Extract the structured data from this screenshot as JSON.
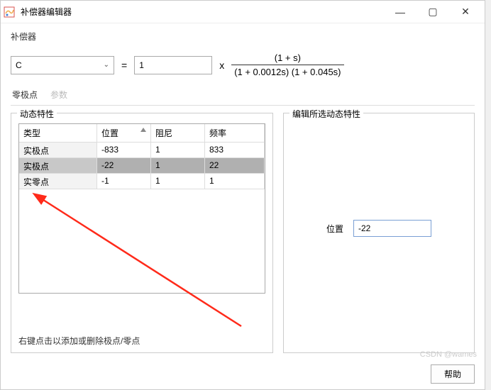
{
  "window": {
    "title": "补偿器编辑器"
  },
  "compensator": {
    "section_label": "补偿器",
    "selected": "C",
    "gain": "1",
    "numerator": "(1 + s)",
    "denominator": "(1 + 0.0012s) (1 + 0.045s)"
  },
  "tabs": {
    "active": "零极点",
    "disabled": "参数"
  },
  "dynamics": {
    "legend": "动态特性",
    "headers": {
      "type": "类型",
      "location": "位置",
      "damping": "阻尼",
      "freq": "频率"
    },
    "rows": [
      {
        "type": "实极点",
        "location": "-833",
        "damping": "1",
        "freq": "833",
        "selected": false
      },
      {
        "type": "实极点",
        "location": "-22",
        "damping": "1",
        "freq": "22",
        "selected": true
      },
      {
        "type": "实零点",
        "location": "-1",
        "damping": "1",
        "freq": "1",
        "selected": false
      }
    ],
    "hint": "右键点击以添加或删除极点/零点"
  },
  "editpanel": {
    "legend": "编辑所选动态特性",
    "label": "位置",
    "value": "-22"
  },
  "footer": {
    "help": "帮助"
  },
  "watermark": "CSDN @wames"
}
